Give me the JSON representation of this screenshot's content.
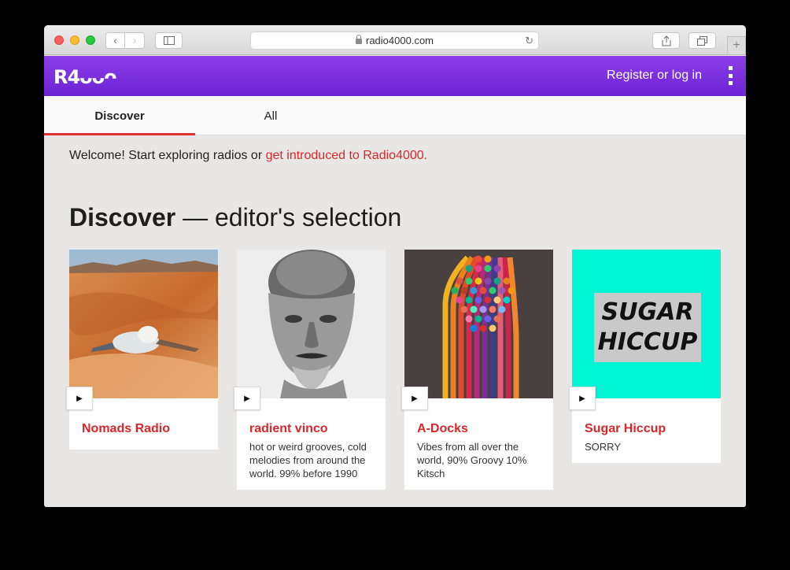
{
  "browser": {
    "url": "radio4000.com"
  },
  "header": {
    "logo": "R4ᴗᴗᴖ",
    "login": "Register or log in"
  },
  "tabs": [
    {
      "label": "Discover",
      "active": true
    },
    {
      "label": "All",
      "active": false
    }
  ],
  "welcome": {
    "text": "Welcome! Start exploring radios or ",
    "link": "get introduced to Radio4000."
  },
  "section": {
    "title_bold": "Discover",
    "title_rest": " — editor's selection"
  },
  "channels": [
    {
      "title": "Nomads Radio",
      "description": ""
    },
    {
      "title": "radient vinco",
      "description": "hot or weird grooves, cold melodies from around the world. 99% before 1990"
    },
    {
      "title": "A-Docks",
      "description": "Vibes from all over the world, 90% Groovy 10% Kitsch"
    },
    {
      "title": "Sugar Hiccup",
      "description": "SORRY",
      "art_text": "SUGAR HICCUP"
    }
  ],
  "colors": {
    "brand": "#7b2fe0",
    "accent": "#d9262b"
  }
}
